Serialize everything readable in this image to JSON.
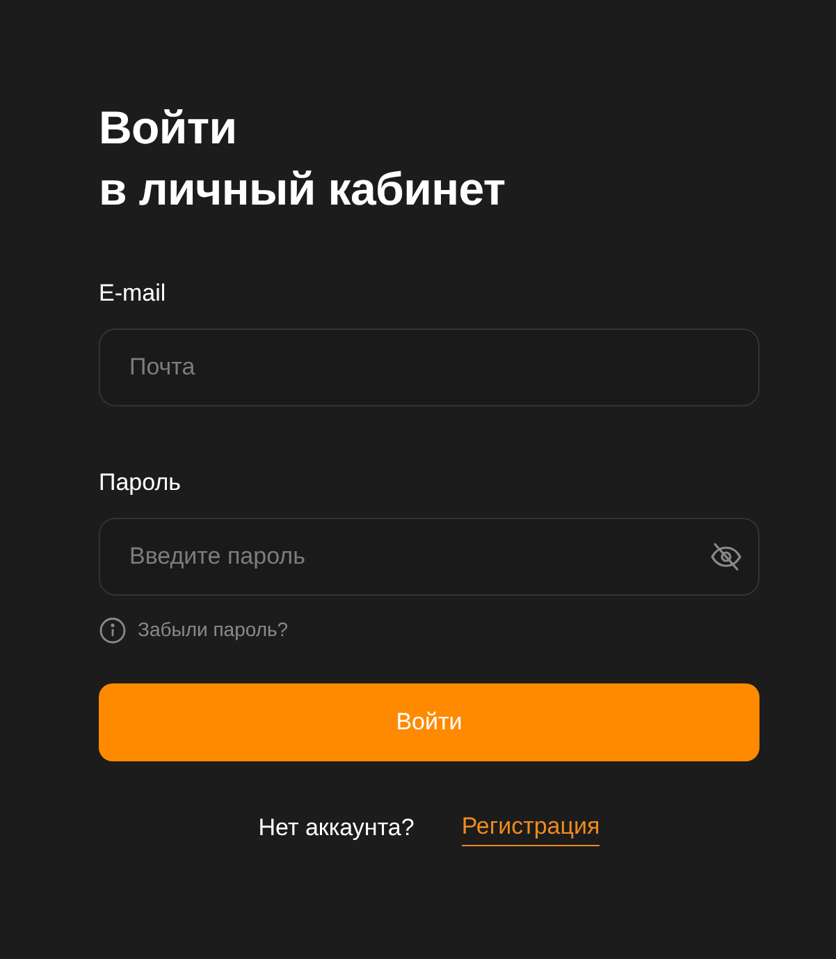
{
  "title_lines": [
    "Войти",
    "в личный кабинет"
  ],
  "fields": [
    {
      "label": "E-mail",
      "placeholder": "Почта",
      "kind": "email"
    },
    {
      "label": "Пароль",
      "placeholder": "Введите пароль",
      "kind": "password"
    }
  ],
  "forgot_link": "Забыли пароль?",
  "submit_button": "Войти",
  "signup": {
    "prompt": "Нет аккаунта?",
    "link": "Регистрация"
  }
}
